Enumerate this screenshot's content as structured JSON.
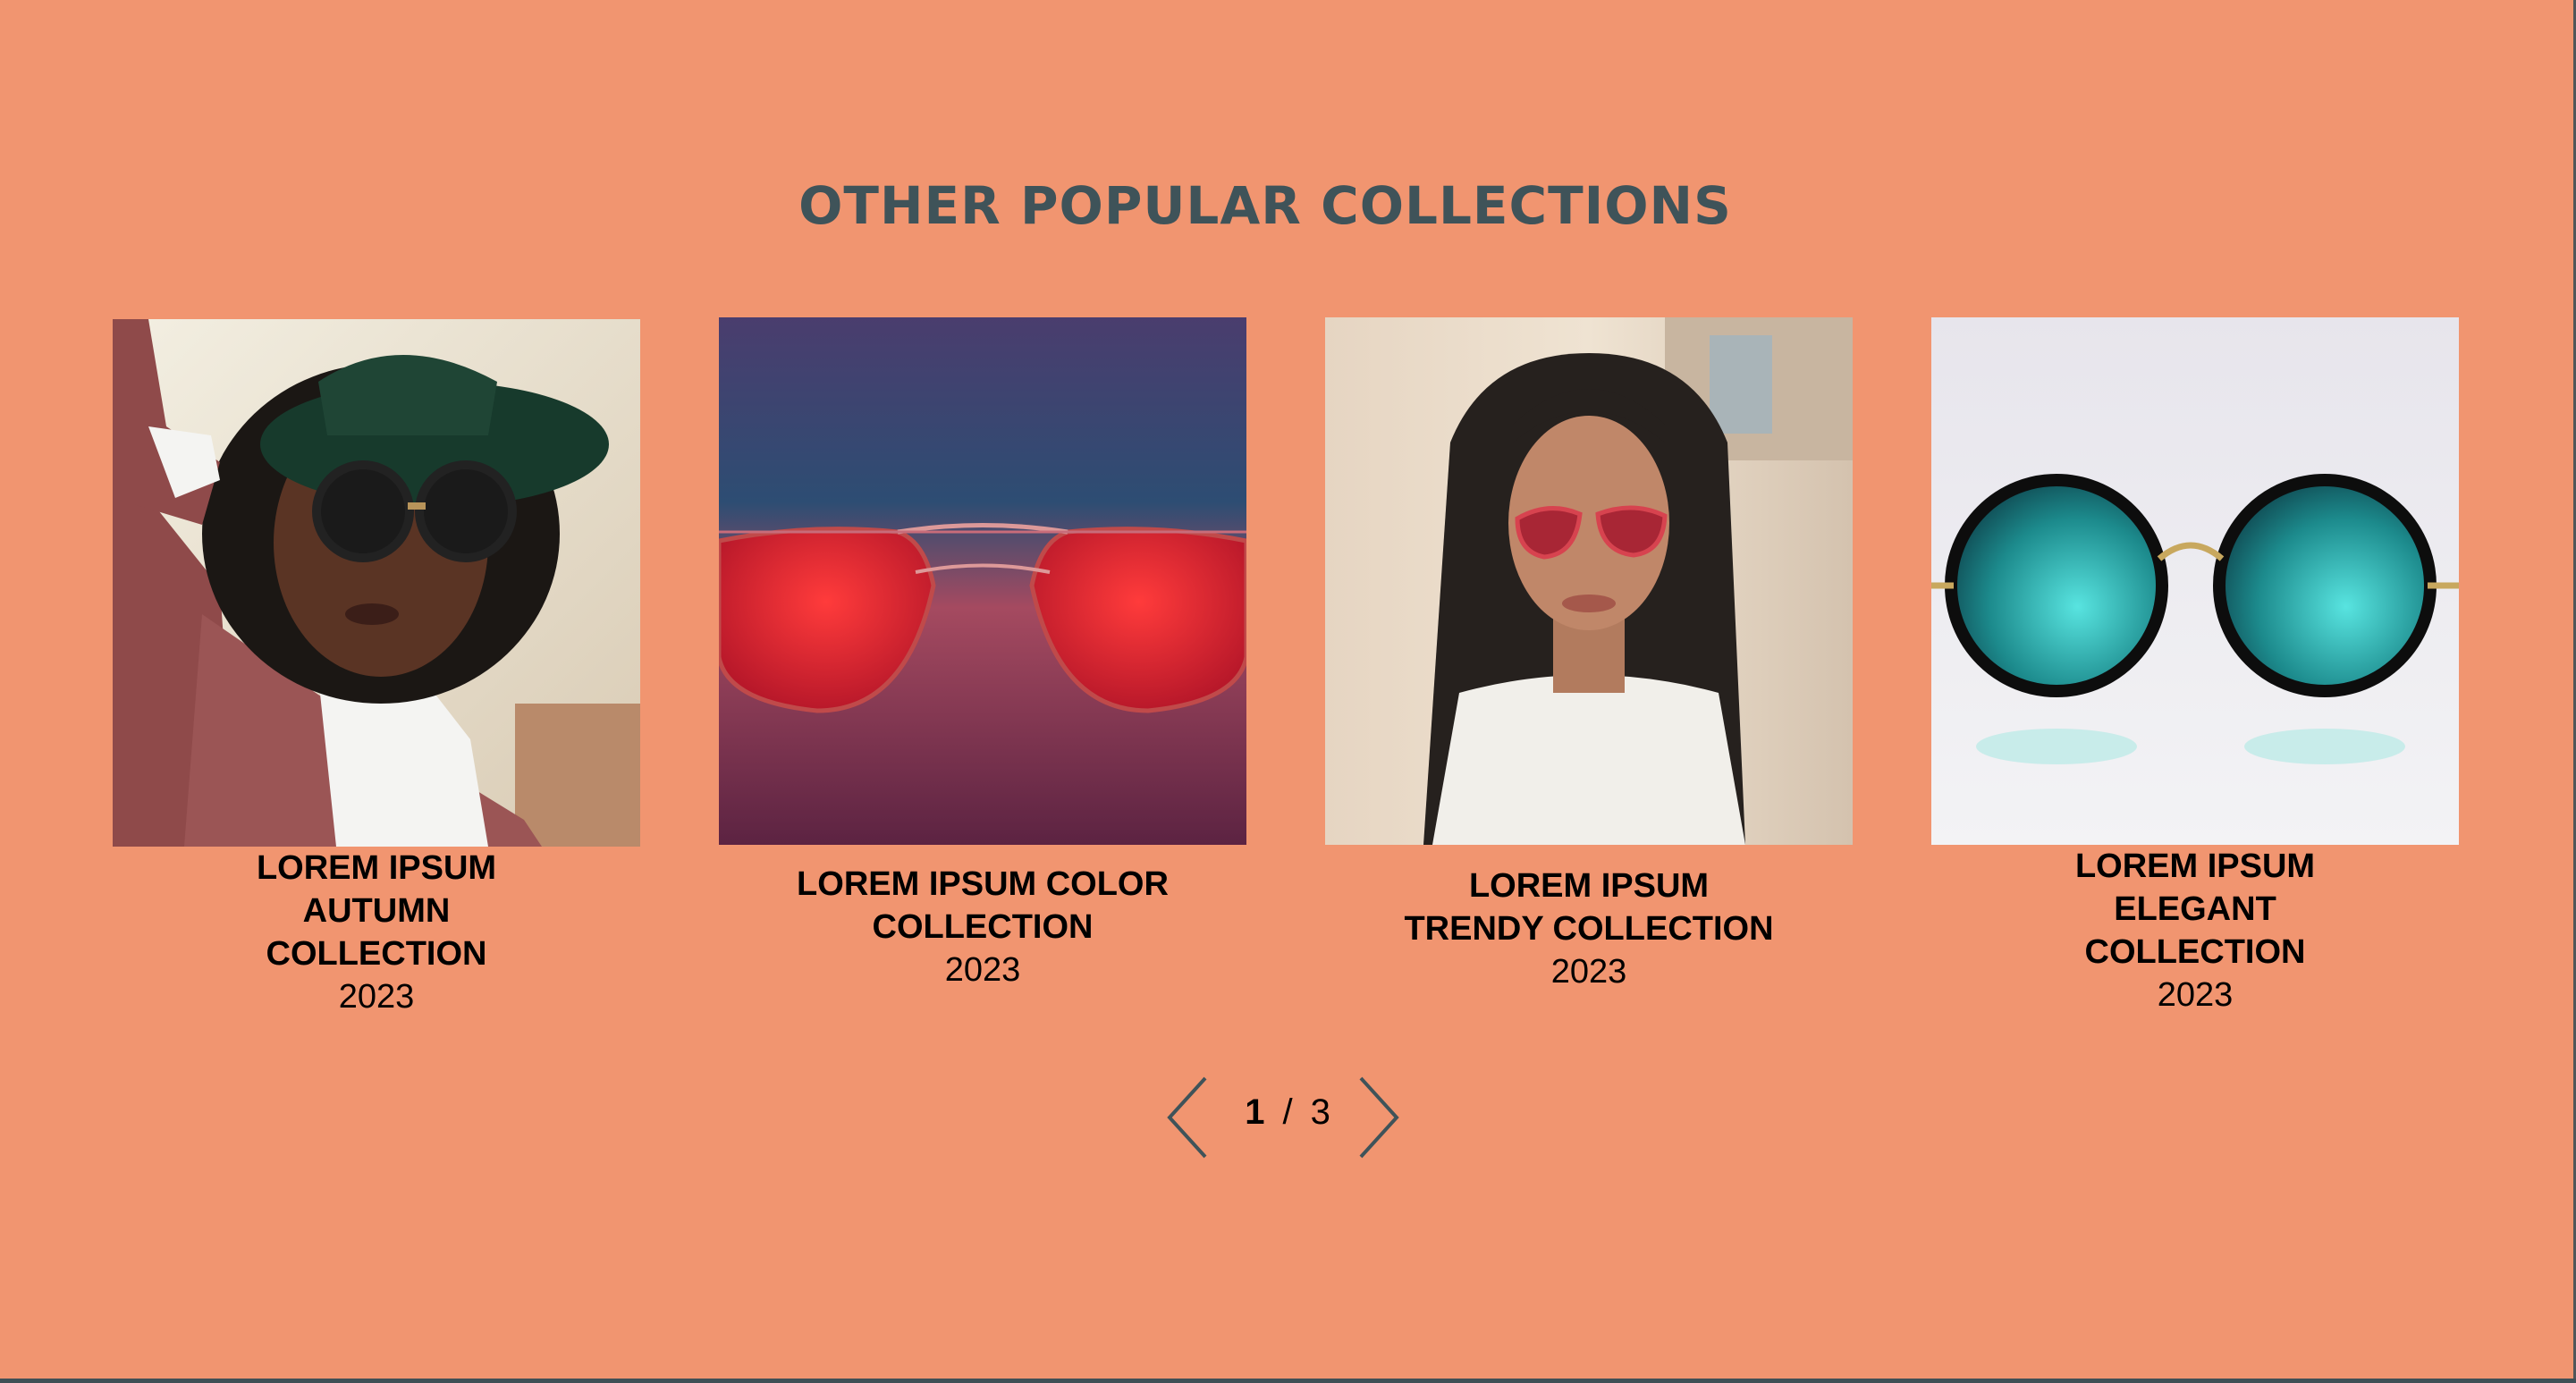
{
  "section": {
    "title": "OTHER POPULAR COLLECTIONS"
  },
  "cards": [
    {
      "title": "LOREM IPSUM\nAUTUMN\nCOLLECTION",
      "year": "2023",
      "image": "woman-in-hat-sunglasses-photo"
    },
    {
      "title": "LOREM IPSUM COLOR\nCOLLECTION",
      "year": "2023",
      "image": "red-aviator-sunglasses-photo"
    },
    {
      "title": "LOREM IPSUM\nTRENDY COLLECTION",
      "year": "2023",
      "image": "woman-braids-cat-eye-sunglasses-photo"
    },
    {
      "title": "LOREM IPSUM\nELEGANT\nCOLLECTION",
      "year": "2023",
      "image": "round-mirrored-sunglasses-photo"
    }
  ],
  "pager": {
    "current": "1",
    "separator": "/",
    "total": "3",
    "prev_icon": "chevron-left-icon",
    "next_icon": "chevron-right-icon"
  },
  "colors": {
    "background": "#f19570",
    "title": "#3f5359",
    "footer_bar": "#3f4f56"
  }
}
